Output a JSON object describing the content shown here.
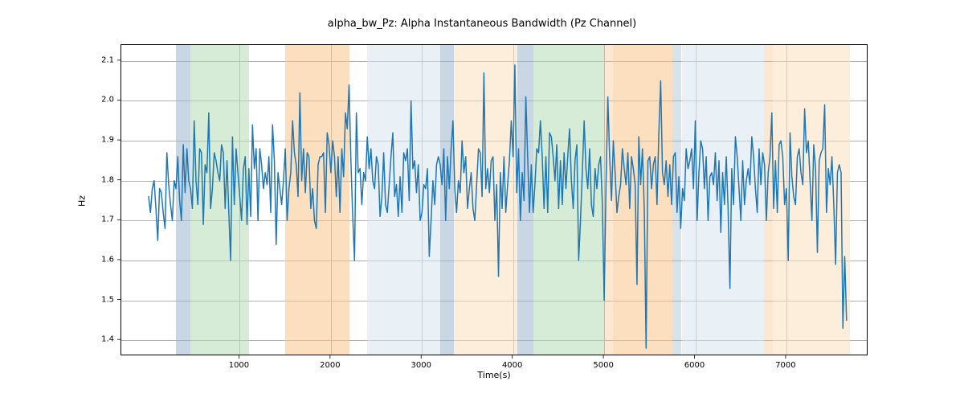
{
  "chart_data": {
    "type": "line",
    "title": "alpha_bw_Pz: Alpha Instantaneous Bandwidth (Pz Channel)",
    "xlabel": "Time(s)",
    "ylabel": "Hz",
    "xlim": [
      -300,
      7900
    ],
    "ylim": [
      1.36,
      2.14
    ],
    "xticks": [
      1000,
      2000,
      3000,
      4000,
      5000,
      6000,
      7000
    ],
    "yticks": [
      1.4,
      1.5,
      1.6,
      1.7,
      1.8,
      1.9,
      2.0,
      2.1
    ],
    "spans": [
      {
        "x0": 300,
        "x1": 460,
        "color": "#9ab7cc",
        "alpha": 0.55
      },
      {
        "x0": 460,
        "x1": 1100,
        "color": "#b5ddb5",
        "alpha": 0.55
      },
      {
        "x0": 1500,
        "x1": 2200,
        "color": "#f7c48b",
        "alpha": 0.55
      },
      {
        "x0": 2400,
        "x1": 3200,
        "color": "#d7e3ef",
        "alpha": 0.55
      },
      {
        "x0": 3200,
        "x1": 3350,
        "color": "#9ab7cc",
        "alpha": 0.55
      },
      {
        "x0": 3350,
        "x1": 4050,
        "color": "#fbe0c0",
        "alpha": 0.55
      },
      {
        "x0": 4050,
        "x1": 4220,
        "color": "#9ab7cc",
        "alpha": 0.55
      },
      {
        "x0": 4220,
        "x1": 5000,
        "color": "#b5ddb5",
        "alpha": 0.55
      },
      {
        "x0": 5000,
        "x1": 5100,
        "color": "#f7c48b",
        "alpha": 0.4
      },
      {
        "x0": 5100,
        "x1": 5750,
        "color": "#f7c48b",
        "alpha": 0.55
      },
      {
        "x0": 5750,
        "x1": 5850,
        "color": "#9ab7cc",
        "alpha": 0.4
      },
      {
        "x0": 5850,
        "x1": 6750,
        "color": "#d7e3ef",
        "alpha": 0.55
      },
      {
        "x0": 6750,
        "x1": 6850,
        "color": "#f7c48b",
        "alpha": 0.4
      },
      {
        "x0": 6850,
        "x1": 7700,
        "color": "#fbe0c0",
        "alpha": 0.55
      }
    ],
    "series": [
      {
        "name": "alpha_bw_Pz",
        "x_step": 20,
        "x_start": 0,
        "values": [
          1.76,
          1.72,
          1.78,
          1.8,
          1.73,
          1.65,
          1.78,
          1.77,
          1.72,
          1.68,
          1.87,
          1.79,
          1.74,
          1.7,
          1.8,
          1.78,
          1.86,
          1.75,
          1.7,
          1.89,
          1.77,
          1.88,
          1.8,
          1.78,
          1.73,
          1.95,
          1.8,
          1.74,
          1.88,
          1.87,
          1.69,
          1.84,
          1.82,
          1.97,
          1.73,
          1.78,
          1.87,
          1.85,
          1.82,
          1.8,
          1.89,
          1.87,
          1.73,
          1.85,
          1.72,
          1.6,
          1.91,
          1.74,
          1.88,
          1.82,
          1.76,
          1.7,
          1.83,
          1.86,
          1.69,
          1.83,
          1.71,
          1.94,
          1.83,
          1.88,
          1.7,
          1.88,
          1.84,
          1.78,
          1.82,
          1.79,
          1.86,
          1.72,
          1.94,
          1.85,
          1.64,
          1.82,
          1.78,
          1.74,
          1.8,
          1.88,
          1.7,
          1.78,
          1.82,
          1.95,
          1.87,
          1.84,
          1.76,
          2.02,
          1.8,
          1.88,
          1.77,
          1.87,
          1.86,
          1.73,
          1.78,
          1.7,
          1.68,
          1.84,
          1.86,
          1.86,
          1.87,
          1.72,
          1.92,
          1.89,
          1.82,
          1.9,
          1.86,
          1.76,
          1.86,
          1.72,
          1.88,
          1.81,
          1.97,
          1.93,
          2.04,
          1.85,
          1.71,
          1.6,
          1.97,
          1.82,
          1.83,
          1.74,
          1.82,
          1.8,
          1.91,
          1.83,
          1.88,
          1.8,
          1.78,
          1.86,
          1.84,
          1.71,
          1.76,
          1.87,
          1.74,
          1.72,
          1.79,
          1.86,
          1.92,
          1.76,
          1.79,
          1.71,
          1.81,
          1.72,
          1.87,
          1.85,
          1.88,
          1.75,
          2.0,
          1.83,
          1.85,
          1.77,
          1.84,
          1.7,
          1.72,
          1.79,
          1.78,
          1.83,
          1.61,
          1.7,
          1.8,
          1.74,
          1.84,
          1.86,
          1.84,
          1.79,
          1.88,
          1.7,
          1.86,
          1.78,
          1.88,
          1.95,
          1.78,
          1.72,
          1.8,
          1.77,
          1.9,
          1.82,
          1.86,
          1.73,
          1.78,
          1.82,
          1.73,
          1.7,
          1.79,
          1.88,
          1.87,
          1.76,
          2.07,
          1.78,
          1.83,
          1.77,
          1.85,
          1.86,
          1.7,
          1.79,
          1.56,
          1.82,
          1.73,
          1.86,
          1.72,
          1.79,
          1.85,
          1.95,
          1.86,
          2.09,
          1.77,
          1.88,
          1.7,
          1.82,
          1.75,
          2.01,
          1.86,
          1.72,
          1.84,
          1.72,
          1.79,
          1.88,
          1.87,
          1.95,
          1.86,
          1.73,
          1.86,
          1.72,
          1.92,
          1.91,
          1.86,
          1.8,
          1.89,
          1.73,
          1.85,
          1.74,
          1.87,
          1.78,
          1.86,
          1.93,
          1.8,
          1.73,
          1.85,
          1.89,
          1.6,
          1.7,
          1.82,
          1.95,
          1.83,
          1.78,
          1.88,
          1.74,
          1.71,
          1.83,
          1.78,
          1.84,
          1.86,
          1.74,
          1.5,
          1.79,
          2.01,
          1.86,
          1.75,
          1.9,
          1.82,
          1.72,
          1.76,
          1.79,
          1.88,
          1.83,
          1.79,
          1.87,
          1.73,
          1.86,
          1.83,
          1.79,
          1.54,
          1.91,
          1.79,
          1.88,
          1.73,
          1.38,
          1.85,
          1.86,
          1.78,
          1.84,
          1.86,
          1.74,
          1.92,
          2.05,
          1.82,
          1.79,
          1.85,
          1.76,
          1.84,
          1.74,
          1.86,
          1.87,
          1.72,
          1.81,
          1.68,
          1.78,
          1.75,
          1.88,
          1.83,
          1.85,
          1.88,
          1.78,
          1.95,
          1.7,
          1.82,
          1.9,
          1.88,
          1.78,
          1.86,
          1.7,
          1.81,
          1.82,
          1.79,
          1.87,
          1.75,
          1.85,
          1.67,
          1.82,
          1.74,
          1.86,
          1.73,
          1.53,
          1.83,
          1.74,
          1.91,
          1.86,
          1.78,
          1.7,
          1.85,
          1.74,
          1.8,
          1.83,
          1.79,
          1.91,
          1.86,
          1.78,
          1.72,
          1.88,
          1.79,
          1.87,
          1.84,
          1.7,
          1.82,
          1.86,
          1.97,
          1.73,
          1.85,
          1.72,
          1.89,
          1.9,
          1.86,
          1.74,
          1.78,
          1.6,
          1.92,
          1.81,
          1.76,
          1.74,
          1.86,
          1.88,
          1.82,
          1.79,
          1.98,
          1.87,
          1.9,
          1.8,
          1.7,
          1.89,
          1.83,
          1.62,
          1.85,
          1.87,
          1.88,
          1.99,
          1.72,
          1.83,
          1.79,
          1.86,
          1.74,
          1.59,
          1.82,
          1.84,
          1.82,
          1.43,
          1.61,
          1.45
        ]
      }
    ]
  }
}
